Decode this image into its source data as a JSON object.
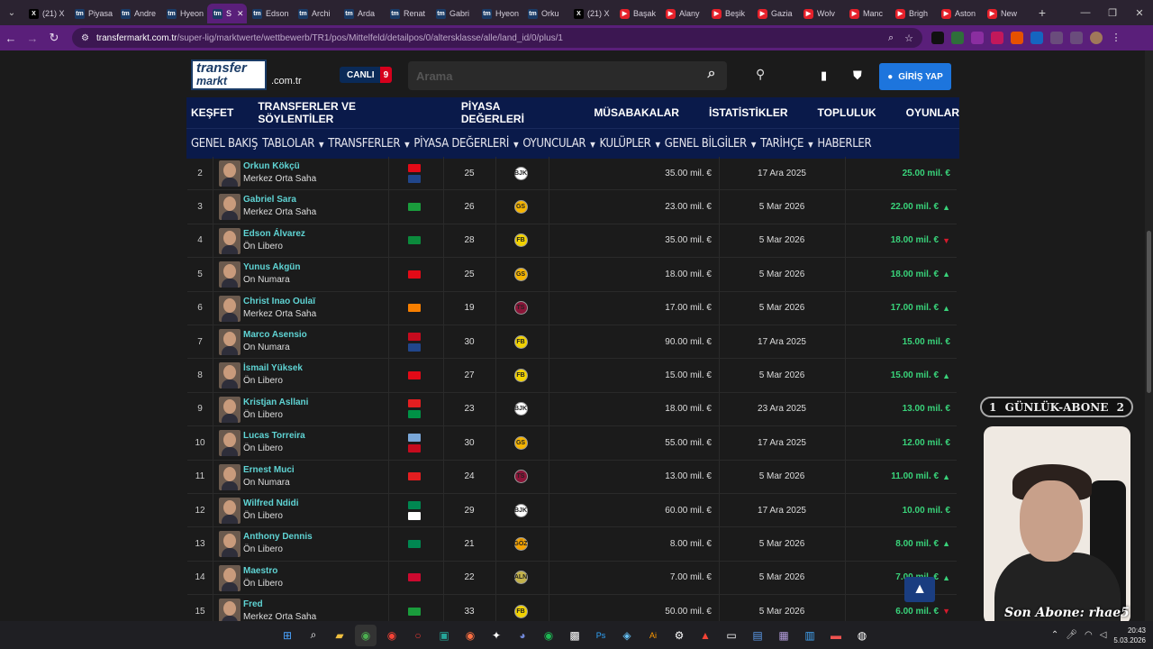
{
  "browser": {
    "tabs": [
      {
        "label": "(21) X",
        "fav": "x"
      },
      {
        "label": "Piyasa",
        "fav": "tm"
      },
      {
        "label": "Andre",
        "fav": "tm"
      },
      {
        "label": "Hyeon",
        "fav": "tm"
      },
      {
        "label": "S",
        "fav": "tm",
        "active": true
      },
      {
        "label": "Edson",
        "fav": "tm"
      },
      {
        "label": "Archi",
        "fav": "tm"
      },
      {
        "label": "Arda",
        "fav": "tm"
      },
      {
        "label": "Renat",
        "fav": "tm"
      },
      {
        "label": "Gabri",
        "fav": "tm"
      },
      {
        "label": "Hyeon",
        "fav": "tm"
      },
      {
        "label": "Orku",
        "fav": "tm"
      },
      {
        "label": "(21) X",
        "fav": "x"
      },
      {
        "label": "Başak",
        "fav": "yt"
      },
      {
        "label": "Alany",
        "fav": "yt"
      },
      {
        "label": "Beşik",
        "fav": "yt"
      },
      {
        "label": "Gazia",
        "fav": "yt"
      },
      {
        "label": "Wolv",
        "fav": "yt"
      },
      {
        "label": "Manc",
        "fav": "yt"
      },
      {
        "label": "Brigh",
        "fav": "yt"
      },
      {
        "label": "Aston",
        "fav": "yt"
      },
      {
        "label": "New",
        "fav": "yt"
      }
    ],
    "url_host": "transfermarkt.com.tr",
    "url_path": "/super-lig/marktwerte/wettbewerb/TR1/pos/Mittelfeld/detailpos/0/altersklasse/alle/land_id/0/plus/1"
  },
  "site": {
    "logo_top": "transfer",
    "logo_bottom": "markt",
    "domain_suffix": ".com.tr",
    "live_label": "CANLI",
    "live_count": "9",
    "search_placeholder": "Arama",
    "login_label": "GİRİŞ YAP",
    "main_nav": [
      "KEŞFET",
      "TRANSFERLER VE SÖYLENTİLER",
      "PİYASA DEĞERLERİ",
      "MÜSABAKALAR",
      "İSTATİSTİKLER",
      "TOPLULUK",
      "OYUNLAR"
    ],
    "sub_nav": [
      "GENEL BAKIŞ",
      "TABLOLAR",
      "TRANSFERLER",
      "PİYASA DEĞERLERİ",
      "OYUNCULAR",
      "KULÜPLER",
      "GENEL BİLGİLER",
      "TARİHÇE",
      "HABERLER"
    ]
  },
  "rows": [
    {
      "rank": "2",
      "name": "Orkun Kökçü",
      "position": "Merkez Orta Saha",
      "flags": [
        "#e30a17",
        "#21468b"
      ],
      "age": "25",
      "club": "BJK",
      "club_color": "#ffffff",
      "prev": "35.00 mil. €",
      "date": "17 Ara 2025",
      "value": "25.00 mil. €",
      "trend": ""
    },
    {
      "rank": "3",
      "name": "Gabriel Sara",
      "position": "Merkez Orta Saha",
      "flags": [
        "#1a9c3c"
      ],
      "age": "26",
      "club": "GS",
      "club_color": "#f5b400",
      "prev": "23.00 mil. €",
      "date": "5 Mar 2026",
      "value": "22.00 mil. €",
      "trend": "up"
    },
    {
      "rank": "4",
      "name": "Edson Álvarez",
      "position": "Ön Libero",
      "flags": [
        "#0b8a3c"
      ],
      "age": "28",
      "club": "FB",
      "club_color": "#f2d200",
      "prev": "35.00 mil. €",
      "date": "5 Mar 2026",
      "value": "18.00 mil. €",
      "trend": "down"
    },
    {
      "rank": "5",
      "name": "Yunus Akgün",
      "position": "On Numara",
      "flags": [
        "#e30a17"
      ],
      "age": "25",
      "club": "GS",
      "club_color": "#f5b400",
      "prev": "18.00 mil. €",
      "date": "5 Mar 2026",
      "value": "18.00 mil. €",
      "trend": "up"
    },
    {
      "rank": "6",
      "name": "Christ Inao Oulaï",
      "position": "Merkez Orta Saha",
      "flags": [
        "#f77f00"
      ],
      "age": "19",
      "club": "TS",
      "club_color": "#8a1538",
      "prev": "17.00 mil. €",
      "date": "5 Mar 2026",
      "value": "17.00 mil. €",
      "trend": "up"
    },
    {
      "rank": "7",
      "name": "Marco Asensio",
      "position": "On Numara",
      "flags": [
        "#c60b1e",
        "#21468b"
      ],
      "age": "30",
      "club": "FB",
      "club_color": "#f2d200",
      "prev": "90.00 mil. €",
      "date": "17 Ara 2025",
      "value": "15.00 mil. €",
      "trend": ""
    },
    {
      "rank": "8",
      "name": "İsmail Yüksek",
      "position": "Ön Libero",
      "flags": [
        "#e30a17"
      ],
      "age": "27",
      "club": "FB",
      "club_color": "#f2d200",
      "prev": "15.00 mil. €",
      "date": "5 Mar 2026",
      "value": "15.00 mil. €",
      "trend": "up"
    },
    {
      "rank": "9",
      "name": "Kristjan Asllani",
      "position": "Ön Libero",
      "flags": [
        "#e41e20",
        "#009246"
      ],
      "age": "23",
      "club": "BJK",
      "club_color": "#ffffff",
      "prev": "18.00 mil. €",
      "date": "23 Ara 2025",
      "value": "13.00 mil. €",
      "trend": ""
    },
    {
      "rank": "10",
      "name": "Lucas Torreira",
      "position": "Ön Libero",
      "flags": [
        "#7aa7d8",
        "#c60b1e"
      ],
      "age": "30",
      "club": "GS",
      "club_color": "#f5b400",
      "prev": "55.00 mil. €",
      "date": "17 Ara 2025",
      "value": "12.00 mil. €",
      "trend": ""
    },
    {
      "rank": "11",
      "name": "Ernest Muci",
      "position": "On Numara",
      "flags": [
        "#e41e20"
      ],
      "age": "24",
      "club": "TS",
      "club_color": "#8a1538",
      "prev": "13.00 mil. €",
      "date": "5 Mar 2026",
      "value": "11.00 mil. €",
      "trend": "up"
    },
    {
      "rank": "12",
      "name": "Wilfred Ndidi",
      "position": "Ön Libero",
      "flags": [
        "#008751",
        "#ffffff"
      ],
      "age": "29",
      "club": "BJK",
      "club_color": "#ffffff",
      "prev": "60.00 mil. €",
      "date": "17 Ara 2025",
      "value": "10.00 mil. €",
      "trend": ""
    },
    {
      "rank": "13",
      "name": "Anthony Dennis",
      "position": "Ön Libero",
      "flags": [
        "#008751"
      ],
      "age": "21",
      "club": "GÖZ",
      "club_color": "#f5a300",
      "prev": "8.00 mil. €",
      "date": "5 Mar 2026",
      "value": "8.00 mil. €",
      "trend": "up"
    },
    {
      "rank": "14",
      "name": "Maestro",
      "position": "Ön Libero",
      "flags": [
        "#cc092f"
      ],
      "age": "22",
      "club": "ALN",
      "club_color": "#c3b24a",
      "prev": "7.00 mil. €",
      "date": "5 Mar 2026",
      "value": "7.00 mil. €",
      "trend": "up"
    },
    {
      "rank": "15",
      "name": "Fred",
      "position": "Merkez Orta Saha",
      "flags": [
        "#1a9c3c"
      ],
      "age": "33",
      "club": "FB",
      "club_color": "#f2d200",
      "prev": "50.00 mil. €",
      "date": "5 Mar 2026",
      "value": "6.00 mil. €",
      "trend": "down"
    }
  ],
  "overlay": {
    "counter_left": "1",
    "counter_title": "GÜNLÜK-ABONE",
    "counter_right": "2",
    "last_sub": "Son Abone: rhae5"
  },
  "taskbar": {
    "time": "20:43",
    "date": "5.03.2026"
  }
}
